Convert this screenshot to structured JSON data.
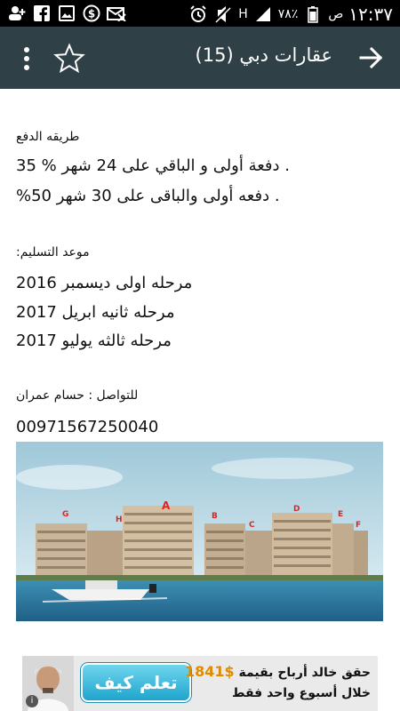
{
  "status_bar": {
    "time": "١٢:٣٧",
    "am_pm": "ص",
    "battery": "٧٨٪",
    "network": "H",
    "icons_left": [
      "add-user-icon",
      "facebook-icon",
      "image-icon",
      "dollar-icon",
      "email-off-icon"
    ],
    "icons_right": [
      "alarm-icon",
      "mute-icon",
      "signal-icon"
    ]
  },
  "app_bar": {
    "title": "عقارات دبي (15)",
    "icons": [
      "back-arrow-icon",
      "star-icon",
      "more-vert-icon"
    ]
  },
  "content": {
    "payment_title": "طريقه الدفع",
    "payment_1": ". دفعة أولى و الباقي على 24 شهر % 35",
    "payment_2": ". دفعه أولى والباقى على 30 شهر 50%",
    "delivery_title": "موعد التسليم:",
    "delivery_1": "مرحله اولى ديسمبر 2016",
    "delivery_2": "مرحله ثانيه ابريل 2017",
    "delivery_3": "مرحله ثالثه يوليو 2017",
    "contact": "للتواصل : حسام عمران",
    "phone": "00971567250040"
  },
  "photo_labels": [
    "A",
    "B",
    "C",
    "D",
    "E",
    "F",
    "G",
    "H"
  ],
  "ad": {
    "line1_text": "حقق خالد أرباح بقيمة",
    "line1_price": "$1841",
    "line2": "خلال أسبوع  واحد فقط",
    "button": "تعلم كيف",
    "info": "i"
  },
  "colors": {
    "app_bar": "#2f4046",
    "status_bar": "#000000",
    "ad_button": "#1fa4cd",
    "ad_price": "#e08a00"
  }
}
